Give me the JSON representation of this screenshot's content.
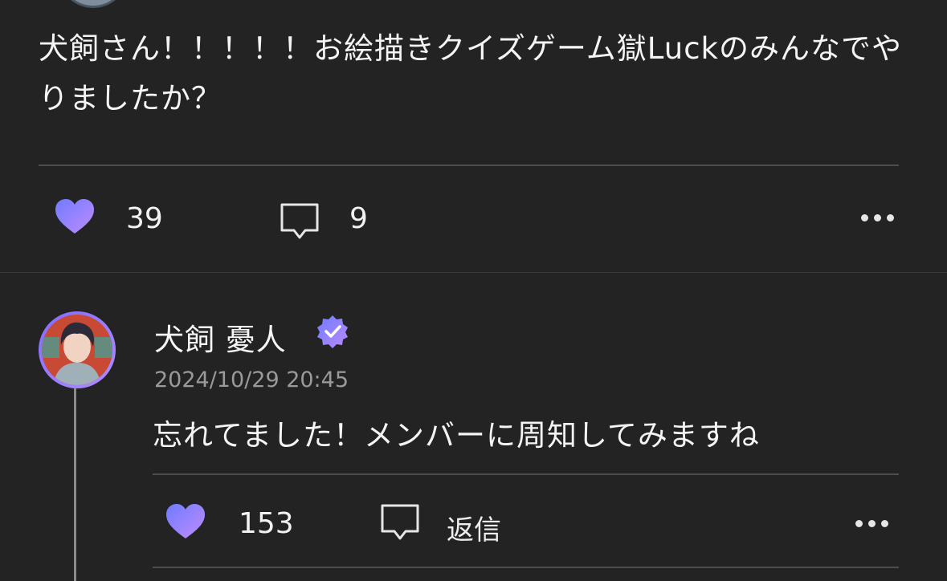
{
  "post": {
    "text": "犬飼さん！！！！！お絵描きクイズゲーム獄Luckのみんなでやりましたか？",
    "likes": "39",
    "comments": "9"
  },
  "reply": {
    "author": "犬飼 憂人",
    "timestamp": "2024/10/29 20:45",
    "text": "忘れてました！メンバーに周知してみますね",
    "likes": "153",
    "reply_label": "返信"
  },
  "icons": {
    "like": "heart-icon",
    "comment": "comment-bubble-icon",
    "more": "more-dots-icon",
    "verified": "verified-badge-icon"
  },
  "colors": {
    "background": "#232323",
    "accent_gradient_start": "#6f7bff",
    "accent_gradient_end": "#b98bff"
  }
}
